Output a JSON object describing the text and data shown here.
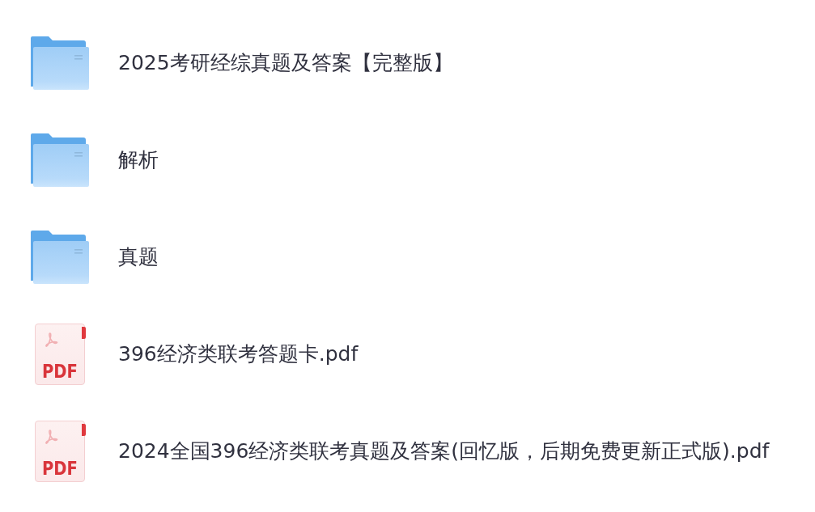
{
  "items": [
    {
      "kind": "folder",
      "name": "2025考研经综真题及答案【完整版】"
    },
    {
      "kind": "folder",
      "name": "解析"
    },
    {
      "kind": "folder",
      "name": "真题"
    },
    {
      "kind": "pdf",
      "name": "396经济类联考答题卡.pdf",
      "type_label": "PDF"
    },
    {
      "kind": "pdf",
      "name": "2024全国396经济类联考真题及答案(回忆版，后期免费更新正式版).pdf",
      "type_label": "PDF"
    }
  ]
}
